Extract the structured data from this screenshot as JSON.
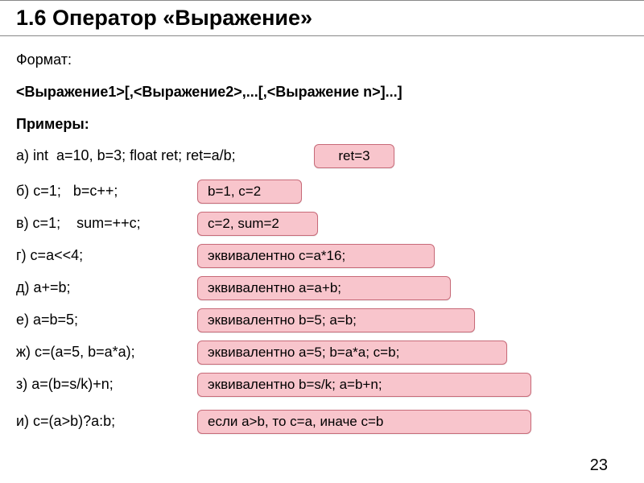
{
  "title": "1.6 Оператор «Выражение»",
  "format_label": "Формат:",
  "format_syntax": "<Выражение1>[,<Выражение2>,...[,<Выражение n>]...]",
  "examples_label": "Примеры:",
  "rows": {
    "a": {
      "label": "а) int  a=10, b=3; float ret; ret=a/b;",
      "badge": "ret=3"
    },
    "b": {
      "label": "б) c=1;   b=c++;",
      "badge": "b=1,  c=2"
    },
    "v": {
      "label": "в) c=1;    sum=++c;",
      "badge": "c=2, sum=2"
    },
    "g": {
      "label": "г) c=a<<4;",
      "badge": "эквивалентно c=a*16;"
    },
    "d": {
      "label": "д) a+=b;",
      "badge": "эквивалентно a=a+b;"
    },
    "e": {
      "label": "е) a=b=5;",
      "badge": "эквивалентно b=5; a=b;"
    },
    "zh": {
      "label": "ж) c=(a=5, b=a*a);",
      "badge": "эквивалентно a=5; b=a*a; c=b;"
    },
    "z": {
      "label": "з) a=(b=s/k)+n;",
      "badge": "эквивалентно b=s/k; a=b+n;"
    },
    "i": {
      "label": "и) c=(a>b)?a:b;",
      "badge": "если a>b, то c=a, иначе c=b"
    }
  },
  "page_number": "23"
}
